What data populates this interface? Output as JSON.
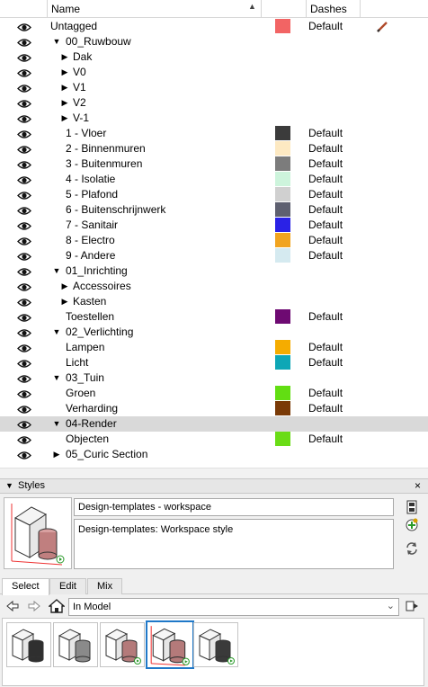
{
  "tags": {
    "columns": {
      "name": "Name",
      "dashes": "Dashes"
    },
    "rows": [
      {
        "label": "Untagged",
        "color": "#f26464",
        "dashes": "Default",
        "depth": 0,
        "expander": "",
        "editable": true
      },
      {
        "label": "00_Ruwbouw",
        "color": "",
        "dashes": "",
        "depth": 1,
        "expander": "▼"
      },
      {
        "label": "Dak",
        "color": "",
        "dashes": "",
        "depth": 2,
        "expander": "▶"
      },
      {
        "label": "V0",
        "color": "",
        "dashes": "",
        "depth": 2,
        "expander": "▶"
      },
      {
        "label": "V1",
        "color": "",
        "dashes": "",
        "depth": 2,
        "expander": "▶"
      },
      {
        "label": "V2",
        "color": "",
        "dashes": "",
        "depth": 2,
        "expander": "▶"
      },
      {
        "label": "V-1",
        "color": "",
        "dashes": "",
        "depth": 2,
        "expander": "▶"
      },
      {
        "label": "1 - Vloer",
        "color": "#3b3b3b",
        "dashes": "Default",
        "depth": 2,
        "expander": ""
      },
      {
        "label": "2 - Binnenmuren",
        "color": "#fde9c2",
        "dashes": "Default",
        "depth": 2,
        "expander": ""
      },
      {
        "label": "3 - Buitenmuren",
        "color": "#7c7c7c",
        "dashes": "Default",
        "depth": 2,
        "expander": ""
      },
      {
        "label": "4 - Isolatie",
        "color": "#cdf4dc",
        "dashes": "Default",
        "depth": 2,
        "expander": ""
      },
      {
        "label": "5 - Plafond",
        "color": "#d0d0d0",
        "dashes": "Default",
        "depth": 2,
        "expander": ""
      },
      {
        "label": "6 - Buitenschrijnwerk",
        "color": "#5e6070",
        "dashes": "Default",
        "depth": 2,
        "expander": ""
      },
      {
        "label": "7 - Sanitair",
        "color": "#2a22e6",
        "dashes": "Default",
        "depth": 2,
        "expander": ""
      },
      {
        "label": "8 - Electro",
        "color": "#f1a420",
        "dashes": "Default",
        "depth": 2,
        "expander": ""
      },
      {
        "label": "9 - Andere",
        "color": "#d5eaf0",
        "dashes": "Default",
        "depth": 2,
        "expander": ""
      },
      {
        "label": "01_Inrichting",
        "color": "",
        "dashes": "",
        "depth": 1,
        "expander": "▼"
      },
      {
        "label": "Accessoires",
        "color": "",
        "dashes": "",
        "depth": 2,
        "expander": "▶"
      },
      {
        "label": "Kasten",
        "color": "",
        "dashes": "",
        "depth": 2,
        "expander": "▶"
      },
      {
        "label": "Toestellen",
        "color": "#6e0a72",
        "dashes": "Default",
        "depth": 2,
        "expander": ""
      },
      {
        "label": "02_Verlichting",
        "color": "",
        "dashes": "",
        "depth": 1,
        "expander": "▼"
      },
      {
        "label": "Lampen",
        "color": "#f5ac00",
        "dashes": "Default",
        "depth": 2,
        "expander": ""
      },
      {
        "label": "Licht",
        "color": "#0ea7b6",
        "dashes": "Default",
        "depth": 2,
        "expander": ""
      },
      {
        "label": "03_Tuin",
        "color": "",
        "dashes": "",
        "depth": 1,
        "expander": "▼"
      },
      {
        "label": "Groen",
        "color": "#62de12",
        "dashes": "Default",
        "depth": 2,
        "expander": ""
      },
      {
        "label": "Verharding",
        "color": "#7a3a06",
        "dashes": "Default",
        "depth": 2,
        "expander": ""
      },
      {
        "label": "04-Render",
        "color": "",
        "dashes": "",
        "depth": 1,
        "expander": "▼",
        "selected": true
      },
      {
        "label": "Objecten",
        "color": "#6adc16",
        "dashes": "Default",
        "depth": 2,
        "expander": ""
      },
      {
        "label": "05_Curic Section",
        "color": "",
        "dashes": "",
        "depth": 1,
        "expander": "▶"
      }
    ]
  },
  "styles": {
    "title": "Styles",
    "name": "Design-templates - workspace",
    "description": "Design-templates:  Workspace style",
    "tabs": [
      "Select",
      "Edit",
      "Mix"
    ],
    "active_tab": "Select",
    "collection": "In Model",
    "thumbnails": [
      {
        "id": "style-1",
        "cyl": "#2f2f2f"
      },
      {
        "id": "style-2",
        "cyl": "#8a8a8a"
      },
      {
        "id": "style-3",
        "cyl": "#b47a7a"
      },
      {
        "id": "style-4",
        "cyl": "#b47a7a",
        "selected": true
      },
      {
        "id": "style-5",
        "cyl": "#3a3a3a"
      }
    ]
  }
}
